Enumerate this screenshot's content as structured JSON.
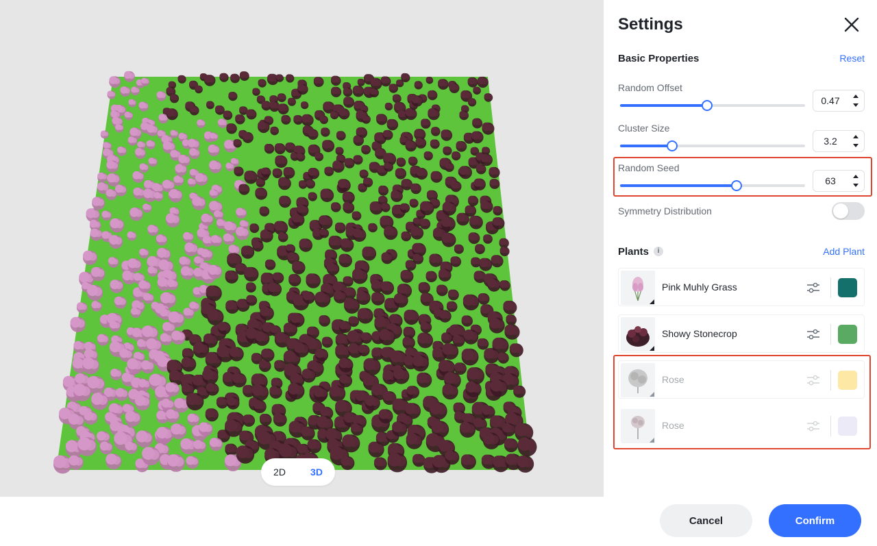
{
  "viewport": {
    "view_modes": {
      "two_d": "2D",
      "three_d": "3D",
      "active": "3D"
    }
  },
  "panel": {
    "title": "Settings",
    "basic": {
      "heading": "Basic Properties",
      "reset_label": "Reset",
      "random_offset": {
        "label": "Random Offset",
        "value": "0.47",
        "fraction": 0.47
      },
      "cluster_size": {
        "label": "Cluster Size",
        "value": "3.2",
        "fraction": 0.28
      },
      "random_seed": {
        "label": "Random Seed",
        "value": "63",
        "fraction": 0.63
      },
      "symmetry": {
        "label": "Symmetry Distribution",
        "on": false
      }
    },
    "plants": {
      "heading": "Plants",
      "add_label": "Add Plant",
      "items": [
        {
          "name": "Pink Muhly Grass",
          "color": "#13706a",
          "enabled": true
        },
        {
          "name": "Showy Stonecrop",
          "color": "#5aaa63",
          "enabled": true
        },
        {
          "name": "Rose",
          "color": "#fde8a6",
          "enabled": false
        },
        {
          "name": "Rose",
          "color": "#eceaf7",
          "enabled": false
        }
      ]
    },
    "cancel_label": "Cancel",
    "confirm_label": "Confirm"
  },
  "colors": {
    "accent": "#3370ff",
    "highlight": "#e0462f",
    "ground": "#5ec43c",
    "pink_plant": "#d597c7",
    "dark_plant": "#5a2a38"
  }
}
